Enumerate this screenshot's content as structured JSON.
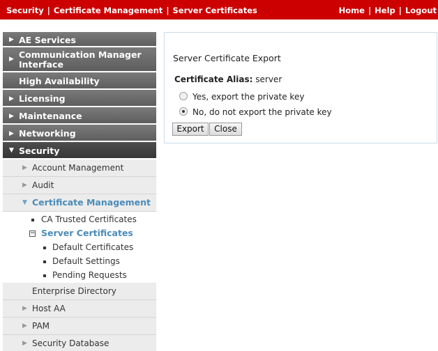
{
  "header": {
    "breadcrumb": [
      "Security",
      "Certificate Management",
      "Server Certificates"
    ],
    "links": [
      "Home",
      "Help",
      "Logout"
    ]
  },
  "sidebar": {
    "top_items": [
      {
        "label": "AE Services",
        "arrow": "▶"
      },
      {
        "label_line1": "Communication Manager",
        "label_line2": "Interface",
        "arrow": "▶"
      },
      {
        "label": "High Availability"
      },
      {
        "label": "Licensing",
        "arrow": "▶"
      },
      {
        "label": "Maintenance",
        "arrow": "▶"
      },
      {
        "label": "Networking",
        "arrow": "▶"
      },
      {
        "label": "Security",
        "arrow": "▼"
      }
    ],
    "security_items": [
      {
        "label": "Account Management",
        "arrow": "▶"
      },
      {
        "label": "Audit",
        "arrow": "▶"
      },
      {
        "label": "Certificate Management",
        "arrow": "▼"
      }
    ],
    "cert_items": {
      "ca_trusted": "CA Trusted Certificates",
      "server_certs": "Server Certificates",
      "default_certs": "Default Certificates",
      "default_settings": "Default Settings",
      "pending_requests": "Pending Requests"
    },
    "lower_items": [
      {
        "label": "Enterprise Directory"
      },
      {
        "label": "Host AA",
        "arrow": "▶"
      },
      {
        "label": "PAM",
        "arrow": "▶"
      },
      {
        "label": "Security Database",
        "arrow": "▶"
      }
    ]
  },
  "panel": {
    "title": "Server Certificate Export",
    "alias_label": "Certificate Alias:",
    "alias_value": "server",
    "options": [
      {
        "label": "Yes, export the private key",
        "checked": false
      },
      {
        "label": "No, do not export the private key",
        "checked": true
      }
    ],
    "export_label": "Export",
    "close_label": "Close"
  },
  "colors": {
    "topbar": "#cc0000",
    "nav_dark": "#5e5e5e",
    "nav_open": "#373737",
    "nav_light": "#ececec",
    "active_link": "#4a8cb9",
    "panel_border": "#c9dbe8"
  }
}
